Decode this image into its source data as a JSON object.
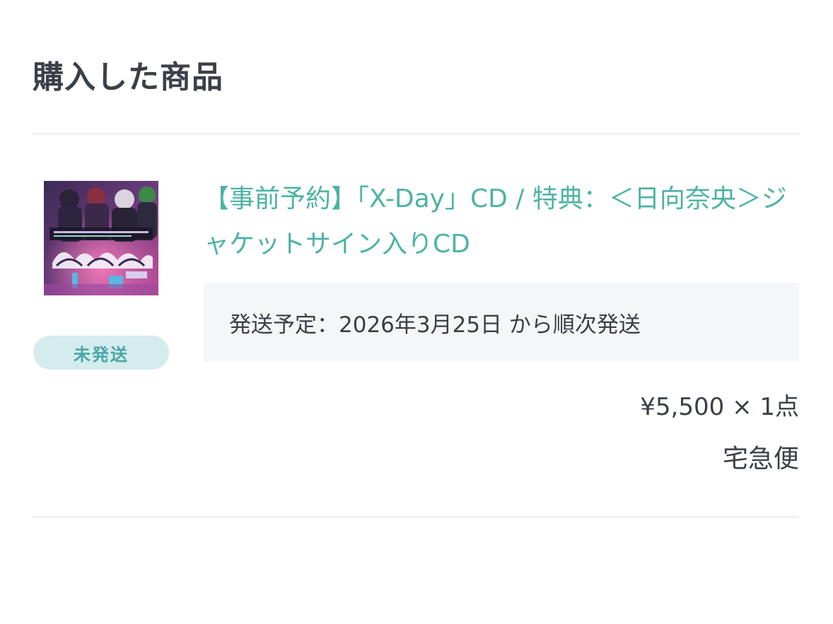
{
  "section": {
    "title": "購入した商品"
  },
  "order_item": {
    "product_title": "【事前予約】「X-Day」CD / 特典：＜日向奈央＞ジャケットサイン入りCD",
    "status_badge": "未発送",
    "shipping_schedule": "発送予定：2026年3月25日 から順次発送",
    "price_quantity": "¥5,500 × 1点",
    "delivery_method": "宅急便",
    "thumbnail_icon": "cd-jacket-image"
  },
  "colors": {
    "title_text": "#3b4048",
    "product_link": "#4db3a4",
    "badge_bg": "#d4eced",
    "badge_text": "#4aa6a6",
    "shipping_box_bg": "#f5f6f7",
    "divider": "#eef0f2"
  }
}
